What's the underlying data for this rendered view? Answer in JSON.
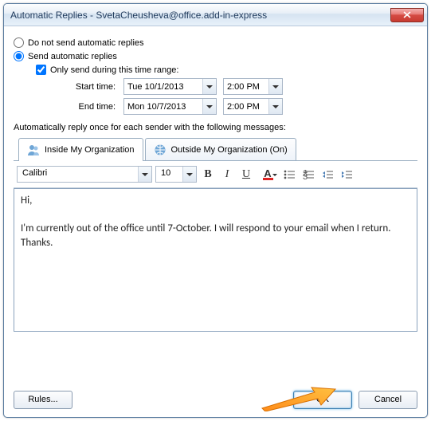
{
  "title": "Automatic Replies - SvetaCheusheva@office.add-in-express",
  "radio": {
    "dont": "Do not send automatic replies",
    "send": "Send automatic replies"
  },
  "only_range": "Only send during this time range:",
  "start": {
    "label": "Start time:",
    "date": "Tue 10/1/2013",
    "time": "2:00 PM"
  },
  "end": {
    "label": "End time:",
    "date": "Mon 10/7/2013",
    "time": "2:00 PM"
  },
  "auto_text": "Automatically reply once for each sender with the following messages:",
  "tabs": {
    "inside": "Inside My Organization",
    "outside": "Outside My Organization (On)"
  },
  "font": {
    "name": "Calibri",
    "size": "10"
  },
  "message": "Hi,\n\nI'm currently out of the office until 7-October. I will respond to your email when I return.\nThanks.",
  "buttons": {
    "rules": "Rules...",
    "ok": "OK",
    "cancel": "Cancel"
  },
  "colors": {
    "accent": "#3c7fb1"
  }
}
